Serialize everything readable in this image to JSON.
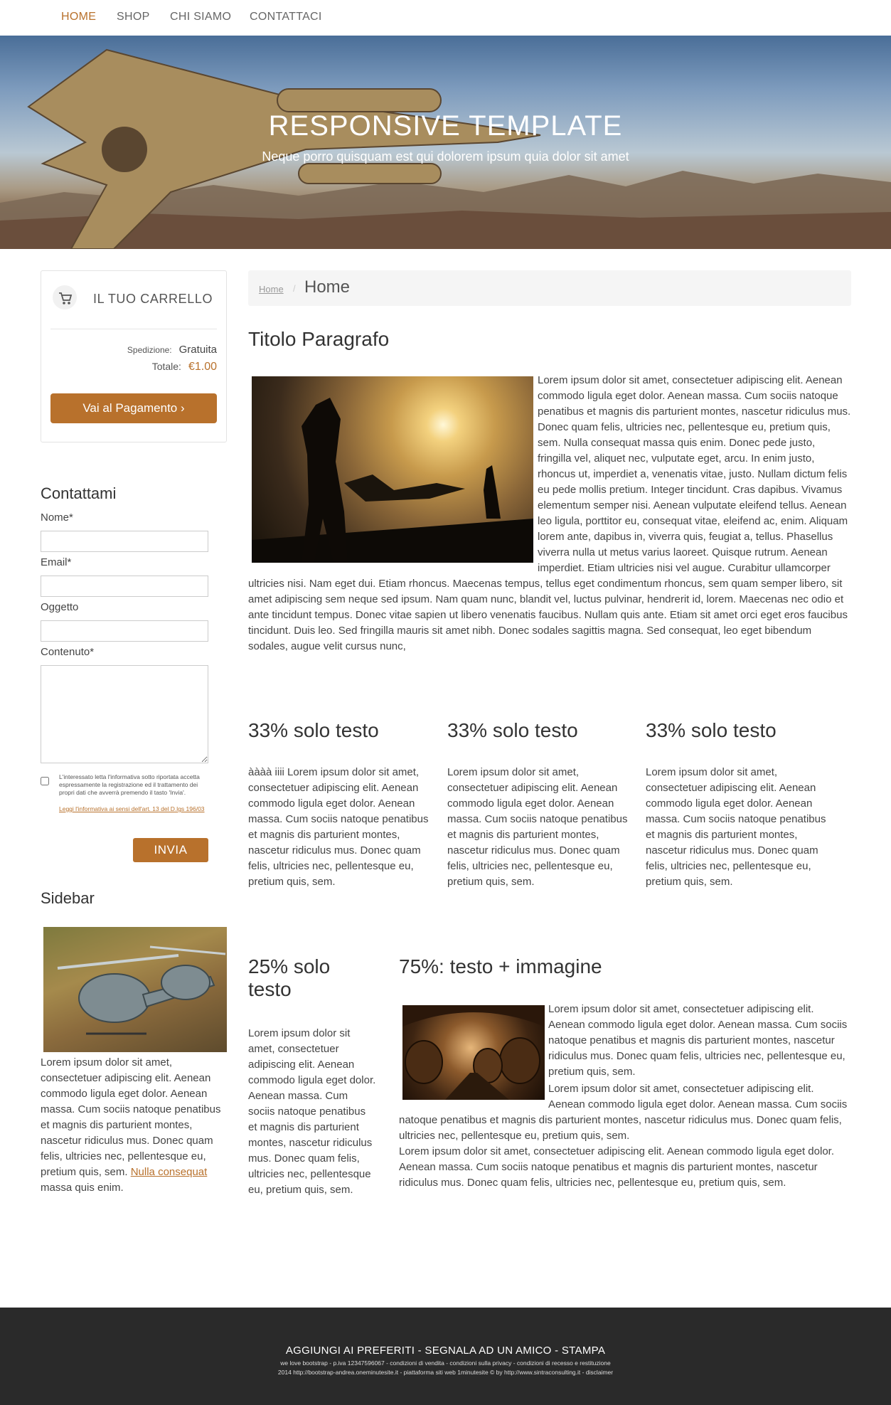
{
  "nav": {
    "items": [
      {
        "label": "HOME",
        "active": true
      },
      {
        "label": "SHOP",
        "active": false
      },
      {
        "label": "CHI SIAMO",
        "active": false
      },
      {
        "label": "CONTATTACI",
        "active": false
      }
    ]
  },
  "hero": {
    "title": "RESPONSIVE TEMPLATE",
    "subtitle": "Neque porro quisquam est qui dolorem ipsum quia dolor sit amet"
  },
  "cart": {
    "icon": "cart-icon",
    "title": "IL TUO CARRELLO",
    "shipping_label": "Spedizione:",
    "shipping_value": "Gratuita",
    "total_label": "Totale:",
    "total_value": "€1.00",
    "checkout_label": "Vai al Pagamento ›"
  },
  "contact": {
    "title": "Contattami",
    "name_label": "Nome*",
    "email_label": "Email*",
    "subject_label": "Oggetto",
    "content_label": "Contenuto*",
    "consent_text": "L'interessato letta l'informativa sotto riportata accetta espressamente la registrazione ed il trattamento dei propri dati che avverrà premendo il tasto 'Invia'.",
    "consent_link": "Leggi l'informativa ai sensi dell'art. 13 del D.lgs 196/03",
    "submit_label": "INVIA"
  },
  "sidebar": {
    "title": "Sidebar",
    "text_before": "Lorem ipsum dolor sit amet, consectetuer adipiscing elit. Aenean commodo ligula eget dolor. Aenean massa. Cum sociis natoque penatibus et magnis dis parturient montes, nascetur ridiculus mus. Donec quam felis, ultricies nec, pellentesque eu, pretium quis, sem. ",
    "link": "Nulla consequat",
    "text_after": " massa quis enim."
  },
  "breadcrumb": {
    "home": "Home",
    "separator": "/",
    "current": "Home"
  },
  "main": {
    "title": "Titolo Paragrafo",
    "paragraph": "Lorem ipsum dolor sit amet, consectetuer adipiscing elit. Aenean commodo ligula eget dolor. Aenean massa. Cum sociis natoque penatibus et magnis dis parturient montes, nascetur ridiculus mus. Donec quam felis, ultricies nec, pellentesque eu, pretium quis, sem. Nulla consequat massa quis enim. Donec pede justo, fringilla vel, aliquet nec, vulputate eget, arcu. In enim justo, rhoncus ut, imperdiet a, venenatis vitae, justo. Nullam dictum felis eu pede mollis pretium. Integer tincidunt. Cras dapibus. Vivamus elementum semper nisi. Aenean vulputate eleifend tellus. Aenean leo ligula, porttitor eu, consequat vitae, eleifend ac, enim. Aliquam lorem ante, dapibus in, viverra quis, feugiat a, tellus. Phasellus viverra nulla ut metus varius laoreet. Quisque rutrum. Aenean imperdiet. Etiam ultricies nisi vel augue. Curabitur ullamcorper ultricies nisi. Nam eget dui. Etiam rhoncus. Maecenas tempus, tellus eget condimentum rhoncus, sem quam semper libero, sit amet adipiscing sem neque sed ipsum. Nam quam nunc, blandit vel, luctus pulvinar, hendrerit id, lorem. Maecenas nec odio et ante tincidunt tempus. Donec vitae sapien ut libero venenatis faucibus. Nullam quis ante. Etiam sit amet orci eget eros faucibus tincidunt. Duis leo. Sed fringilla mauris sit amet nibh. Donec sodales sagittis magna. Sed consequat, leo eget bibendum sodales, augue velit cursus nunc,"
  },
  "cols33": [
    {
      "title": "33% solo testo",
      "text": "àààà iiii Lorem ipsum dolor sit amet, consectetuer adipiscing elit. Aenean commodo ligula eget dolor. Aenean massa. Cum sociis natoque penatibus et magnis dis parturient montes, nascetur ridiculus mus. Donec quam felis, ultricies nec, pellentesque eu, pretium quis, sem."
    },
    {
      "title": "33% solo testo",
      "text": "Lorem ipsum dolor sit amet, consectetuer adipiscing elit. Aenean commodo ligula eget dolor. Aenean massa. Cum sociis natoque penatibus et magnis dis parturient montes, nascetur ridiculus mus. Donec quam felis, ultricies nec, pellentesque eu, pretium quis, sem."
    },
    {
      "title": "33% solo testo",
      "text": "Lorem ipsum dolor sit amet, consectetuer adipiscing elit. Aenean commodo ligula eget dolor. Aenean massa. Cum sociis natoque penatibus et magnis dis parturient montes, nascetur ridiculus mus. Donec quam felis, ultricies nec, pellentesque eu, pretium quis, sem."
    }
  ],
  "col25": {
    "title": "25% solo testo",
    "text": "Lorem ipsum dolor sit amet, consectetuer adipiscing elit. Aenean commodo ligula eget dolor. Aenean massa. Cum sociis natoque penatibus et magnis dis parturient montes, nascetur ridiculus mus. Donec quam felis, ultricies nec, pellentesque eu, pretium quis, sem."
  },
  "col75": {
    "title": "75%: testo + immagine",
    "text1": "Lorem ipsum dolor sit amet, consectetuer adipiscing elit. Aenean commodo ligula eget dolor. Aenean massa. Cum sociis natoque penatibus et magnis dis parturient montes, nascetur ridiculus mus. Donec quam felis, ultricies nec, pellentesque eu, pretium quis, sem.",
    "text2": "Lorem ipsum dolor sit amet, consectetuer adipiscing elit. Aenean commodo ligula eget dolor. Aenean massa. Cum sociis natoque penatibus et magnis dis parturient montes, nascetur ridiculus mus. Donec quam felis, ultricies nec, pellentesque eu, pretium quis, sem.",
    "text3": "Lorem ipsum dolor sit amet, consectetuer adipiscing elit. Aenean commodo ligula eget dolor. Aenean massa. Cum sociis natoque penatibus et magnis dis parturient montes, nascetur ridiculus mus. Donec quam felis, ultricies nec, pellentesque eu, pretium quis, sem."
  },
  "footer": {
    "links": "AGGIUNGI AI PREFERITI - SEGNALA AD UN AMICO - STAMPA",
    "line2": "we love bootstrap - p.iva 12347596067 - condizioni di vendita - condizioni sulla privacy - condizioni di recesso e restituzione",
    "line3": "2014 http://bootstrap-andrea.oneminutesite.it - piattaforma siti web 1minutesite © by http://www.sintraconsulting.it - disclaimer"
  }
}
